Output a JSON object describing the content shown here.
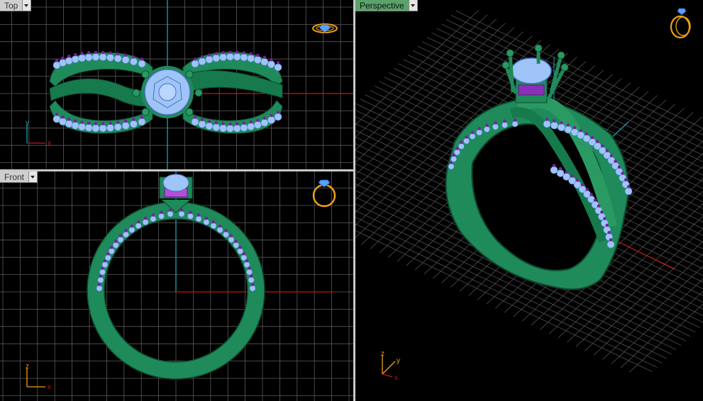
{
  "viewports": {
    "top": {
      "label": "Top"
    },
    "front": {
      "label": "Front"
    },
    "perspective": {
      "label": "Perspective"
    }
  },
  "axis_labels": {
    "top": {
      "x": "x",
      "y": "y"
    },
    "front": {
      "x": "x",
      "z": "z"
    },
    "perspective": {
      "x": "x",
      "y": "y",
      "z": "z"
    }
  },
  "colors": {
    "background": "#000000",
    "grid": "#5a5a5a",
    "grid_major": "#8a8a8a",
    "x_axis": "#c01818",
    "y_axis": "#1ba3a8",
    "metal": "#1f8a5a",
    "metal_dark": "#0f5a3a",
    "metal_light": "#3fc08a",
    "stone": "#9ec4f8",
    "stone_dark": "#5a86d8",
    "bead": "#7a1ea0",
    "active_tab": "#5aa36a",
    "gizmo": "#f0a010"
  },
  "icons": [
    "dropdown-arrow-icon",
    "ring-orientation-icon",
    "axis-gizmo-icon"
  ]
}
